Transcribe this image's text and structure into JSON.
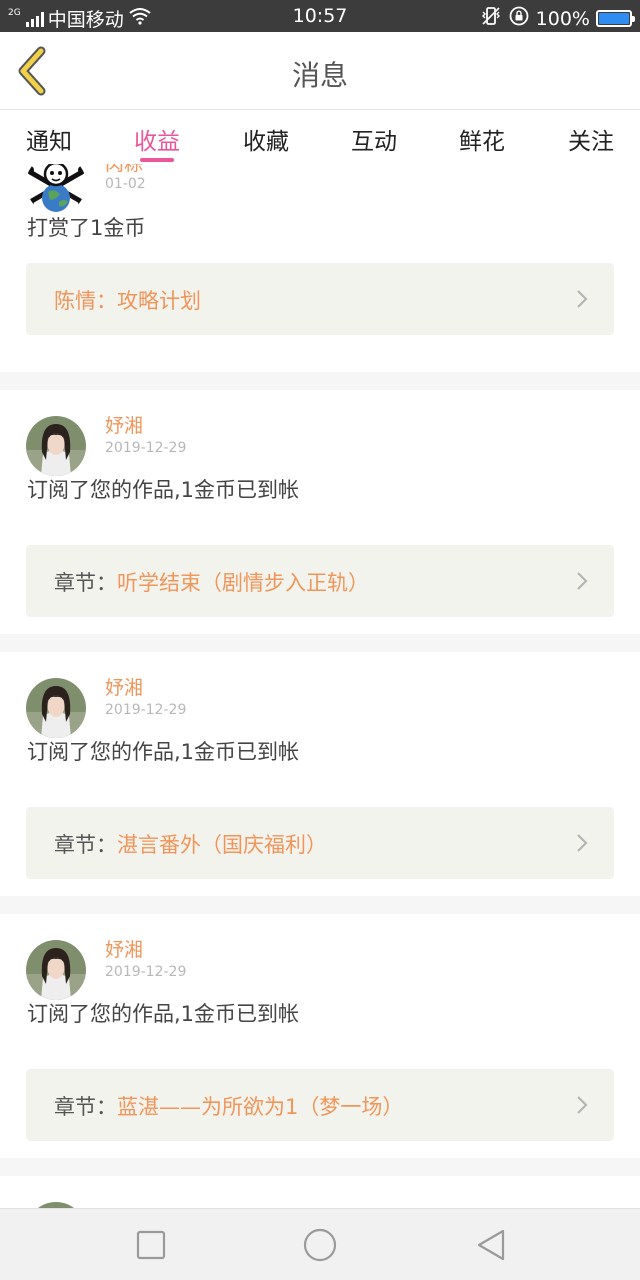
{
  "status_bar": {
    "network": "2G",
    "carrier": "中国移动",
    "time": "10:57",
    "battery": "100%",
    "battery_fill": 1.0,
    "icons": [
      "signal-icon",
      "wifi-icon",
      "vibrate-icon",
      "rotation-lock-icon",
      "battery-icon"
    ]
  },
  "header": {
    "title": "消息",
    "back_icon": "chevron-left-icon"
  },
  "tabs": [
    {
      "label": "通知",
      "active": false
    },
    {
      "label": "收益",
      "active": true
    },
    {
      "label": "收藏",
      "active": false
    },
    {
      "label": "互动",
      "active": false
    },
    {
      "label": "鲜花",
      "active": false
    },
    {
      "label": "关注",
      "active": false
    }
  ],
  "messages": [
    {
      "user": "肉粽",
      "date": "01-02",
      "action": "打赏了1金币",
      "ref_prefix": "",
      "ref_value": "陈情：攻略计划"
    },
    {
      "user": "妤湘",
      "date": "2019-12-29",
      "action": "订阅了您的作品,1金币已到帐",
      "ref_prefix": "章节：",
      "ref_value": "听学结束（剧情步入正轨）"
    },
    {
      "user": "妤湘",
      "date": "2019-12-29",
      "action": "订阅了您的作品,1金币已到帐",
      "ref_prefix": "章节：",
      "ref_value": "湛言番外（国庆福利）"
    },
    {
      "user": "妤湘",
      "date": "2019-12-29",
      "action": "订阅了您的作品,1金币已到帐",
      "ref_prefix": "章节：",
      "ref_value": "蓝湛——为所欲为1（梦一场）"
    }
  ],
  "colors": {
    "accent": "#e9569b",
    "name": "#f0965a",
    "ref_bg": "#f3f3ee",
    "back_arrow": "#f2d14a"
  },
  "nav": [
    "square-icon",
    "circle-icon",
    "triangle-back-icon"
  ]
}
